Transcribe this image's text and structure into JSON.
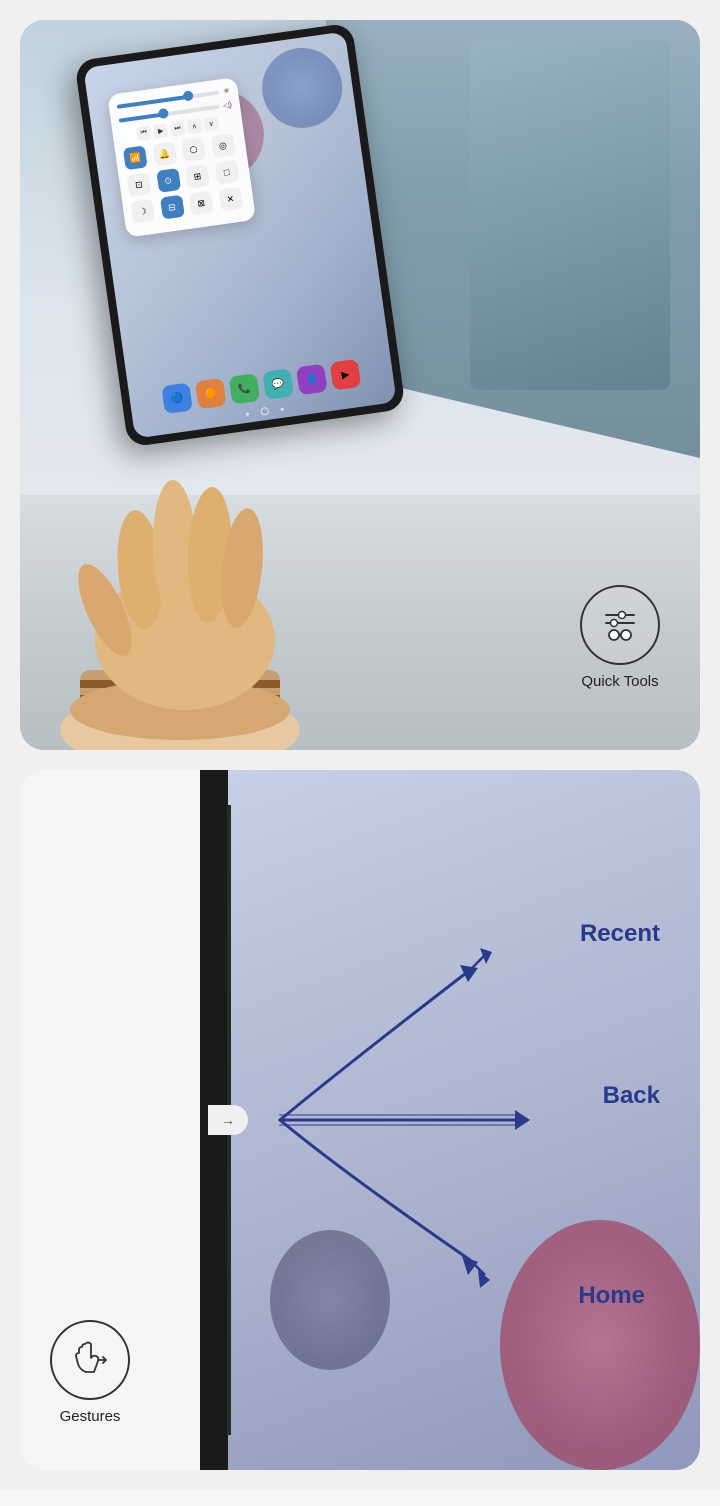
{
  "cards": {
    "top": {
      "title": "Quick Tools",
      "badge_label": "Quick Tools",
      "tablet": {
        "quick_panel": {
          "slider1_label": "brightness",
          "slider2_label": "volume",
          "media_controls": [
            "prev",
            "play",
            "next",
            "up",
            "down"
          ],
          "icons_row1": [
            "wifi",
            "bluetooth",
            "sound",
            "rotate"
          ],
          "icons_row2": [
            "screenshot",
            "record",
            "power",
            "settings"
          ],
          "icons_row3": [
            "moon",
            "icon2",
            "icon3",
            "close"
          ]
        },
        "dock_apps": [
          "blue",
          "orange",
          "green",
          "teal",
          "purple",
          "red"
        ]
      }
    },
    "bottom": {
      "title": "Gestures",
      "badge_label": "Gestures",
      "gesture_labels": {
        "recent": "Recent",
        "back": "Back",
        "home": "Home"
      },
      "edge_arrow": "→"
    }
  }
}
